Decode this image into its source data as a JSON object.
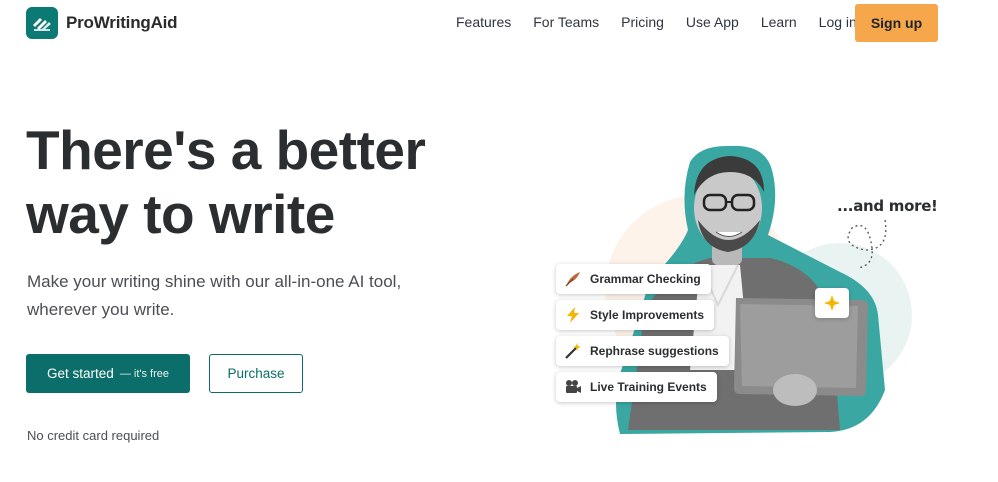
{
  "header": {
    "brand": "ProWritingAid",
    "nav": [
      "Features",
      "For Teams",
      "Pricing",
      "Use App",
      "Learn",
      "Log in"
    ],
    "signup_label": "Sign up"
  },
  "hero": {
    "headline_line1": "There's a better",
    "headline_line2": "way to write",
    "subhead_line1": "Make your writing shine with our all-in-one AI tool,",
    "subhead_line2": "wherever you write.",
    "primary_button": {
      "label": "Get started",
      "sublabel": "— it's free"
    },
    "secondary_button_label": "Purchase",
    "note": "No credit card required"
  },
  "illustration": {
    "features": [
      {
        "label": "Grammar Checking",
        "icon": "quill-icon"
      },
      {
        "label": "Style Improvements",
        "icon": "lightning-icon"
      },
      {
        "label": "Rephrase suggestions",
        "icon": "magic-wand-icon"
      },
      {
        "label": "Live Training Events",
        "icon": "video-camera-icon"
      }
    ],
    "and_more": "...and more!",
    "sparkle_icon": "sparkle-icon"
  },
  "colors": {
    "brand_teal": "#0b6e6a",
    "accent_orange": "#f6a64b",
    "illustration_teal": "#3aa7a3"
  }
}
